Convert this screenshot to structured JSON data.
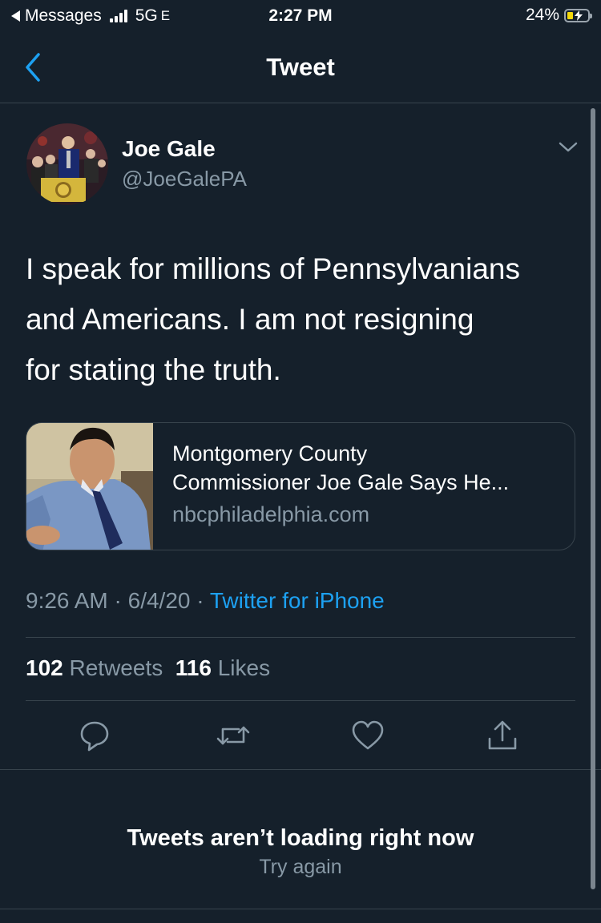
{
  "status_bar": {
    "back_app": "Messages",
    "network": "5G",
    "network_suffix": "E",
    "time": "2:27 PM",
    "battery": "24%",
    "battery_level": 0.24,
    "battery_color": "#f5d90a"
  },
  "nav": {
    "title": "Tweet",
    "back_icon": "chevron-left-icon",
    "accent": "#1da1f2"
  },
  "tweet": {
    "author_name": "Joe Gale",
    "author_handle": "@JoeGalePA",
    "text_lines": [
      "I speak for millions of Pennsylvanians",
      "and Americans.  I am not resigning",
      "for stating the truth."
    ],
    "card": {
      "title_lines": [
        "Montgomery County",
        "Commissioner Joe Gale Says He..."
      ],
      "domain": "nbcphiladelphia.com"
    },
    "time": "9:26 AM",
    "date": "6/4/20",
    "sep": "·",
    "source": "Twitter for iPhone",
    "retweets_count": "102",
    "retweets_label": "Retweets",
    "likes_count": "116",
    "likes_label": "Likes"
  },
  "actions": [
    "reply-icon",
    "retweet-icon",
    "like-icon",
    "share-icon"
  ],
  "empty_state": {
    "title": "Tweets aren’t loading right now",
    "retry": "Try again"
  }
}
